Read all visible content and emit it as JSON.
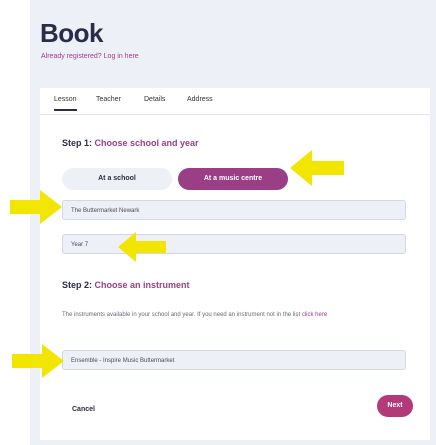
{
  "header": {
    "title": "Book",
    "subtitle_prefix": "Already registered?",
    "login_link": "Log in here"
  },
  "tabs": [
    {
      "label": "Lesson",
      "active": true
    },
    {
      "label": "Teacher",
      "active": false
    },
    {
      "label": "Details",
      "active": false
    },
    {
      "label": "Address",
      "active": false
    }
  ],
  "step1": {
    "label": "Step 1:",
    "title": "Choose school and year",
    "option_school": "At a school",
    "option_music_centre": "At a music centre",
    "selected_option": "At a music centre",
    "centre_value": "The Buttermarket Newark",
    "year_value": "Year 7"
  },
  "step2": {
    "label": "Step 2:",
    "title": "Choose an instrument",
    "description": "The instruments available in your school and year. If you need an instrument not in the list",
    "description_link": "click here",
    "instrument_value": "Ensemble - Inspire Music Buttermarket"
  },
  "footer": {
    "cancel_label": "Cancel",
    "next_label": "Next"
  },
  "colors": {
    "accent": "#9a3e86",
    "next_button": "#b23a78",
    "annotation_arrow": "#f2e600",
    "background": "#eef0f8"
  },
  "annotations": {
    "arrow_count": 4,
    "icon": "arrow-icon"
  }
}
